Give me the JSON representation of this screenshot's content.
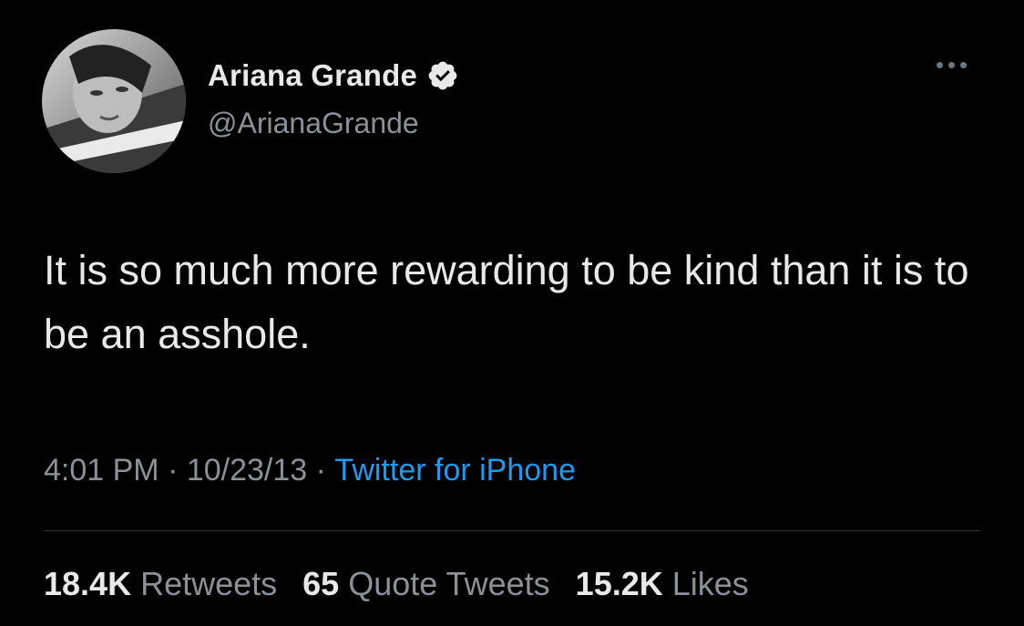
{
  "author": {
    "display_name": "Ariana Grande",
    "handle": "@ArianaGrande",
    "verified": true
  },
  "tweet": {
    "text": "It is so much more rewarding to be kind than it is to be an asshole."
  },
  "meta": {
    "time": "4:01 PM",
    "sep1": " · ",
    "date": "10/23/13",
    "sep2": " · ",
    "source": "Twitter for iPhone"
  },
  "stats": [
    {
      "value": "18.4K",
      "label": "Retweets"
    },
    {
      "value": "65",
      "label": "Quote Tweets"
    },
    {
      "value": "15.2K",
      "label": "Likes"
    }
  ],
  "colors": {
    "background": "#000000",
    "text": "#e7e9ea",
    "secondary": "#8b9197",
    "link": "#1d9bf0",
    "divider": "#2f3336"
  },
  "icons": {
    "verified": "verified-badge-icon",
    "more": "more-options-icon"
  }
}
